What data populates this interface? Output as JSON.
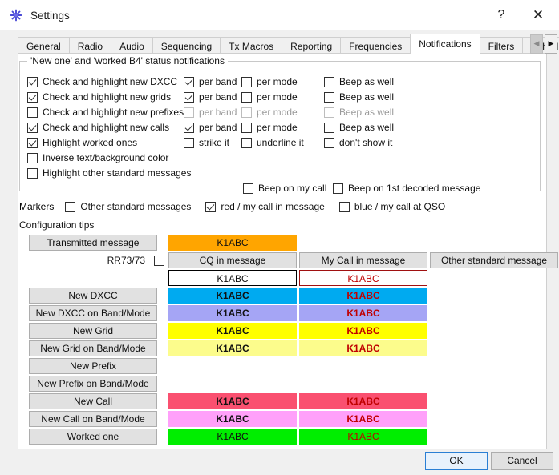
{
  "window": {
    "title": "Settings",
    "icon": "star-asterisk-icon",
    "help_label": "?",
    "close_label": "✕"
  },
  "tabs": [
    {
      "label": "General",
      "selected": false
    },
    {
      "label": "Radio",
      "selected": false
    },
    {
      "label": "Audio",
      "selected": false
    },
    {
      "label": "Sequencing",
      "selected": false
    },
    {
      "label": "Tx Macros",
      "selected": false
    },
    {
      "label": "Reporting",
      "selected": false
    },
    {
      "label": "Frequencies",
      "selected": false
    },
    {
      "label": "Notifications",
      "selected": true
    },
    {
      "label": "Filters",
      "selected": false
    },
    {
      "label": "Schedu",
      "selected": false
    }
  ],
  "tab_scroll": {
    "left": "◀",
    "right": "▶"
  },
  "groupbox": {
    "title": "'New one' and 'worked B4' status notifications",
    "rows": [
      {
        "main": {
          "label": "Check and highlight new DXCC",
          "checked": true,
          "disabled": false
        },
        "band": {
          "label": "per band",
          "checked": true,
          "disabled": false
        },
        "mode": {
          "label": "per mode",
          "checked": false,
          "disabled": false
        },
        "beep": {
          "label": "Beep as well",
          "checked": false,
          "disabled": false
        }
      },
      {
        "main": {
          "label": "Check and highlight new grids",
          "checked": true,
          "disabled": false
        },
        "band": {
          "label": "per band",
          "checked": true,
          "disabled": false
        },
        "mode": {
          "label": "per mode",
          "checked": false,
          "disabled": false
        },
        "beep": {
          "label": "Beep as well",
          "checked": false,
          "disabled": false
        }
      },
      {
        "main": {
          "label": "Check and highlight new prefixes",
          "checked": false,
          "disabled": false
        },
        "band": {
          "label": "per band",
          "checked": false,
          "disabled": true
        },
        "mode": {
          "label": "per mode",
          "checked": false,
          "disabled": true
        },
        "beep": {
          "label": "Beep as well",
          "checked": false,
          "disabled": true
        }
      },
      {
        "main": {
          "label": "Check and highlight new calls",
          "checked": true,
          "disabled": false
        },
        "band": {
          "label": "per band",
          "checked": true,
          "disabled": false
        },
        "mode": {
          "label": "per mode",
          "checked": false,
          "disabled": false
        },
        "beep": {
          "label": "Beep as well",
          "checked": false,
          "disabled": false
        }
      },
      {
        "main": {
          "label": "Highlight worked ones",
          "checked": true,
          "disabled": false
        },
        "band": {
          "label": "strike it",
          "checked": false,
          "disabled": false
        },
        "mode": {
          "label": "underline it",
          "checked": false,
          "disabled": false
        },
        "beep": {
          "label": "don't show it",
          "checked": false,
          "disabled": false
        }
      }
    ],
    "inverse": {
      "label": "Inverse text/background color",
      "checked": false
    },
    "highlight_other": {
      "label": "Highlight other standard messages",
      "checked": false
    },
    "beep_my_call": {
      "label": "Beep on my call",
      "checked": false
    },
    "beep_first_decoded": {
      "label": "Beep on 1st decoded message",
      "checked": false
    }
  },
  "markers": {
    "label": "Markers",
    "items": [
      {
        "label": "Other standard messages",
        "checked": false
      },
      {
        "label": "red / my call in message",
        "checked": true
      },
      {
        "label": "blue / my call at QSO",
        "checked": false
      }
    ]
  },
  "config_tips": {
    "label": "Configuration tips",
    "sample_call": "K1ABC",
    "rr73_label": "RR73/73",
    "rr73_checked": false,
    "column_headers": [
      {
        "label": "CQ in message"
      },
      {
        "label": "My Call in message"
      },
      {
        "label": "Other standard message"
      }
    ],
    "transmitted_label": "Transmitted message",
    "row_labels": [
      "New DXCC",
      "New DXCC on Band/Mode",
      "New Grid",
      "New Grid on Band/Mode",
      "New Prefix",
      "New Prefix on Band/Mode",
      "New Call",
      "New Call on Band/Mode",
      "Worked one"
    ],
    "colors": {
      "transmitted_bg": "#FFA500",
      "transmitted_fg": "#101010",
      "plain_bg": "#FFFFFF",
      "plain_fg": "#101010",
      "plain_border": "#000000",
      "mycall_plain_fg": "#C00000",
      "mycall_plain_border": "#A01010",
      "new_dxcc_bg": "#00AAF0",
      "new_dxcc_bm_bg": "#A5A5F5",
      "new_grid_bg": "#FFFF00",
      "new_grid_bm_bg": "#FCFC8C",
      "new_call_bg": "#FA5070",
      "new_call_bm_bg": "#FFA0FA",
      "worked_bg": "#00EE00",
      "cq_fg": "#101010",
      "mycall_fg": "#C00000",
      "button_face": "#E1E1E1"
    }
  },
  "footer": {
    "ok_label": "OK",
    "cancel_label": "Cancel"
  }
}
